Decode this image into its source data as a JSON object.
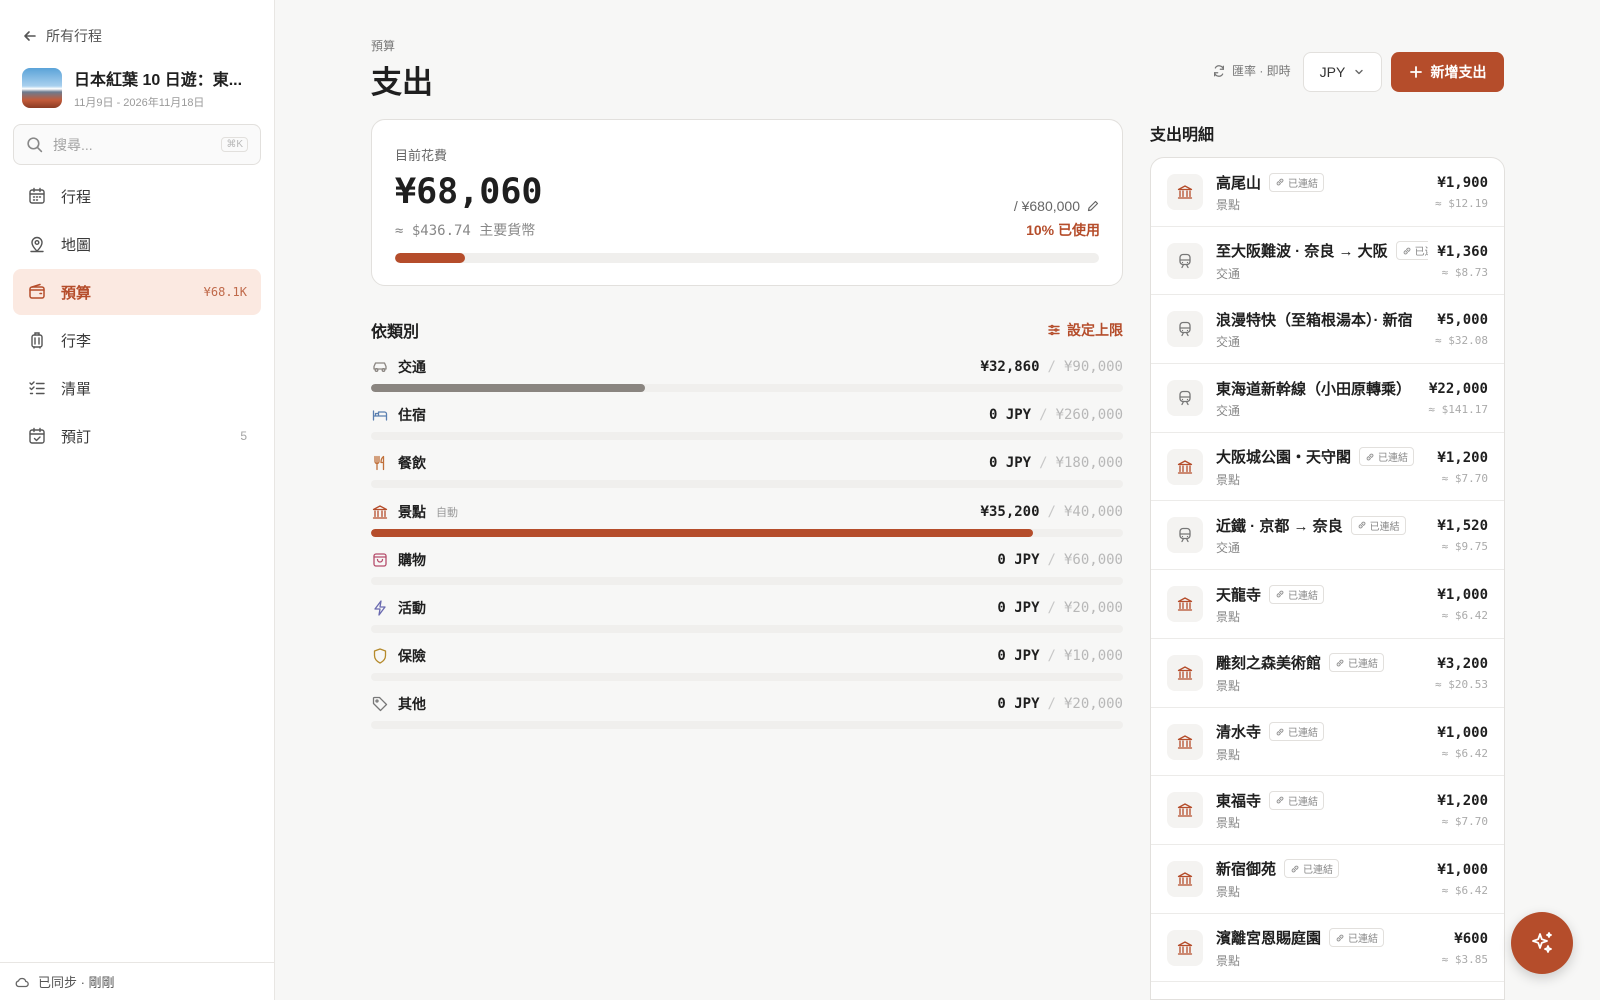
{
  "sidebar": {
    "back_label": "所有行程",
    "trip_title": "日本紅葉 10 日遊：東...",
    "trip_dates": "11月9日  -  2026年11月18日",
    "search_placeholder": "搜尋...",
    "search_shortcut": "⌘K",
    "nav": [
      {
        "label": "行程",
        "icon": "calendar-icon",
        "badge": ""
      },
      {
        "label": "地圖",
        "icon": "map-pin-icon",
        "badge": ""
      },
      {
        "label": "預算",
        "icon": "wallet-icon",
        "badge": "¥68.1K",
        "active": true
      },
      {
        "label": "行李",
        "icon": "luggage-icon",
        "badge": ""
      },
      {
        "label": "清單",
        "icon": "checklist-icon",
        "badge": ""
      },
      {
        "label": "預訂",
        "icon": "calendar-check-icon",
        "badge": "5"
      }
    ],
    "sync_label": "已同步 · 剛剛"
  },
  "header": {
    "eyebrow": "預算",
    "title": "支出",
    "rate_label": "匯率 · 即時",
    "currency": "JPY",
    "add_button": "新增支出"
  },
  "summary": {
    "label": "目前花費",
    "amount": "¥68,060",
    "approx": "≈  $436.74  主要貨幣",
    "limit": "/ ¥680,000",
    "used": "10% 已使用",
    "used_fraction": 0.1
  },
  "categories_section": {
    "title": "依類別",
    "set_limit": "設定上限",
    "items": [
      {
        "name": "交通",
        "icon": "car-icon",
        "spent": "¥32,860",
        "budget": "¥90,000",
        "fraction": 0.365,
        "color": "#8a8580",
        "auto": ""
      },
      {
        "name": "住宿",
        "icon": "bed-icon",
        "spent": "0 JPY",
        "budget": "¥260,000",
        "fraction": 0,
        "color": "#5a7fb0",
        "auto": ""
      },
      {
        "name": "餐飲",
        "icon": "utensils-icon",
        "spent": "0 JPY",
        "budget": "¥180,000",
        "fraction": 0,
        "color": "#c0703a",
        "auto": ""
      },
      {
        "name": "景點",
        "icon": "landmark-icon",
        "spent": "¥35,200",
        "budget": "¥40,000",
        "fraction": 0.88,
        "color": "#b54d2b",
        "auto": "自動"
      },
      {
        "name": "購物",
        "icon": "shopping-bag-icon",
        "spent": "0 JPY",
        "budget": "¥60,000",
        "fraction": 0,
        "color": "#b54d6b",
        "auto": ""
      },
      {
        "name": "活動",
        "icon": "lightning-icon",
        "spent": "0 JPY",
        "budget": "¥20,000",
        "fraction": 0,
        "color": "#6a6ab0",
        "auto": ""
      },
      {
        "name": "保險",
        "icon": "shield-icon",
        "spent": "0 JPY",
        "budget": "¥10,000",
        "fraction": 0,
        "color": "#b58a2b",
        "auto": ""
      },
      {
        "name": "其他",
        "icon": "tag-icon",
        "spent": "0 JPY",
        "budget": "¥20,000",
        "fraction": 0,
        "color": "#777777",
        "auto": ""
      }
    ]
  },
  "expenses": {
    "title": "支出明細",
    "items": [
      {
        "name": "高尾山",
        "tag": "已連結",
        "category": "景點",
        "amount": "¥1,900",
        "approx": "≈ $12.19",
        "icon": "landmark-icon"
      },
      {
        "name": "至大阪難波 · 奈良 → 大阪",
        "tag": "已連結",
        "category": "交通",
        "amount": "¥1,360",
        "approx": "≈ $8.73",
        "icon": "train-icon"
      },
      {
        "name": "浪漫特快（至箱根湯本）· 新宿",
        "tag": "",
        "category": "交通",
        "amount": "¥5,000",
        "approx": "≈ $32.08",
        "icon": "train-icon"
      },
      {
        "name": "東海道新幹線（小田原轉乘）",
        "tag": "",
        "category": "交通",
        "amount": "¥22,000",
        "approx": "≈ $141.17",
        "icon": "train-icon"
      },
      {
        "name": "大阪城公園・天守閣",
        "tag": "已連結",
        "category": "景點",
        "amount": "¥1,200",
        "approx": "≈ $7.70",
        "icon": "landmark-icon"
      },
      {
        "name": "近鐵 · 京都 → 奈良",
        "tag": "已連結",
        "category": "交通",
        "amount": "¥1,520",
        "approx": "≈ $9.75",
        "icon": "train-icon"
      },
      {
        "name": "天龍寺",
        "tag": "已連結",
        "category": "景點",
        "amount": "¥1,000",
        "approx": "≈ $6.42",
        "icon": "landmark-icon"
      },
      {
        "name": "雕刻之森美術館",
        "tag": "已連結",
        "category": "景點",
        "amount": "¥3,200",
        "approx": "≈ $20.53",
        "icon": "landmark-icon"
      },
      {
        "name": "清水寺",
        "tag": "已連結",
        "category": "景點",
        "amount": "¥1,000",
        "approx": "≈ $6.42",
        "icon": "landmark-icon"
      },
      {
        "name": "東福寺",
        "tag": "已連結",
        "category": "景點",
        "amount": "¥1,200",
        "approx": "≈ $7.70",
        "icon": "landmark-icon"
      },
      {
        "name": "新宿御苑",
        "tag": "已連結",
        "category": "景點",
        "amount": "¥1,000",
        "approx": "≈ $6.42",
        "icon": "landmark-icon"
      },
      {
        "name": "濱離宮恩賜庭園",
        "tag": "已連結",
        "category": "景點",
        "amount": "¥600",
        "approx": "≈ $3.85",
        "icon": "landmark-icon"
      }
    ]
  },
  "colors": {
    "accent": "#b54d2b",
    "accent_soft": "#fbe9e1"
  }
}
